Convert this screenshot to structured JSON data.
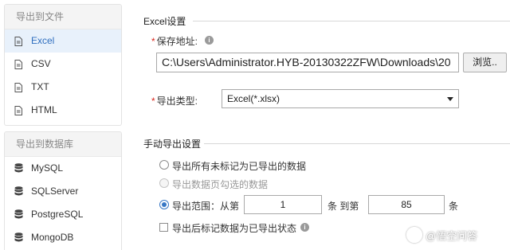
{
  "sidebar": {
    "file_group": {
      "title": "导出到文件",
      "items": [
        {
          "label": "Excel",
          "icon": "file-icon",
          "active": true
        },
        {
          "label": "CSV",
          "icon": "file-icon",
          "active": false
        },
        {
          "label": "TXT",
          "icon": "file-icon",
          "active": false
        },
        {
          "label": "HTML",
          "icon": "file-icon",
          "active": false
        }
      ]
    },
    "db_group": {
      "title": "导出到数据库",
      "items": [
        {
          "label": "MySQL",
          "icon": "database-icon"
        },
        {
          "label": "SQLServer",
          "icon": "database-icon"
        },
        {
          "label": "PostgreSQL",
          "icon": "database-icon"
        },
        {
          "label": "MongoDB",
          "icon": "database-icon"
        }
      ]
    }
  },
  "excel_settings": {
    "title": "Excel设置",
    "save_path_label": "保存地址:",
    "required_mark": "*",
    "save_path_value": "C:\\Users\\Administrator.HYB-20130322ZFW\\Downloads\\20",
    "browse_label": "浏览..",
    "export_type_label": "导出类型:",
    "export_type_value": "Excel(*.xlsx)"
  },
  "manual_export": {
    "title": "手动导出设置",
    "option_all": "导出所有未标记为已导出的数据",
    "option_page": "导出数据页勾选的数据",
    "option_range_prefix": "导出范围：从第",
    "range_from": "1",
    "range_mid": "条 到第",
    "range_to": "85",
    "range_suffix": "条",
    "mark_after_export": "导出后标记数据为已导出状态",
    "selected_option": "range"
  },
  "watermark": {
    "text": "@悟空问答"
  },
  "colors": {
    "accent": "#3777c5",
    "required": "#d9261c",
    "active_bg": "#e8f1fb"
  }
}
